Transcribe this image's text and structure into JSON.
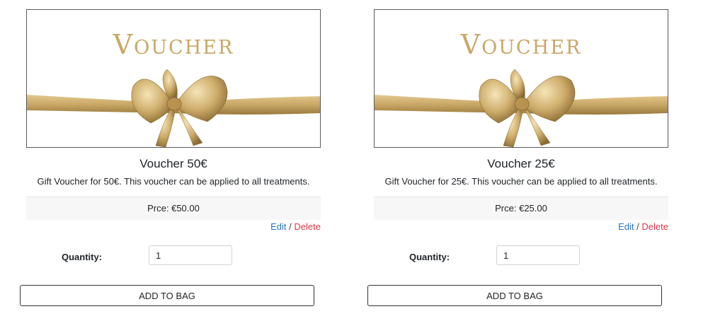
{
  "colors": {
    "gold": "#c9a765",
    "gold_dark": "#8a6a32",
    "link_blue": "#2a73c6",
    "delete_red": "#dc3545",
    "price_bg": "#f7f7f7"
  },
  "cards": [
    {
      "image_text": "Voucher",
      "title": "Voucher 50€",
      "description": "Gift Voucher for 50€. This voucher can be applied to all treatments.",
      "price": "Prce: €50.00",
      "edit_label": "Edit",
      "separator": "/",
      "delete_label": "Delete",
      "quantity_label": "Quantity:",
      "quantity_value": "1",
      "add_button_label": "ADD TO BAG"
    },
    {
      "image_text": "Voucher",
      "title": "Voucher 25€",
      "description": "Gift Voucher for 25€. This voucher can be applied to all treatments.",
      "price": "Prce: €25.00",
      "edit_label": "Edit",
      "separator": "/",
      "delete_label": "Delete",
      "quantity_label": "Quantity:",
      "quantity_value": "1",
      "add_button_label": "ADD TO BAG"
    }
  ]
}
